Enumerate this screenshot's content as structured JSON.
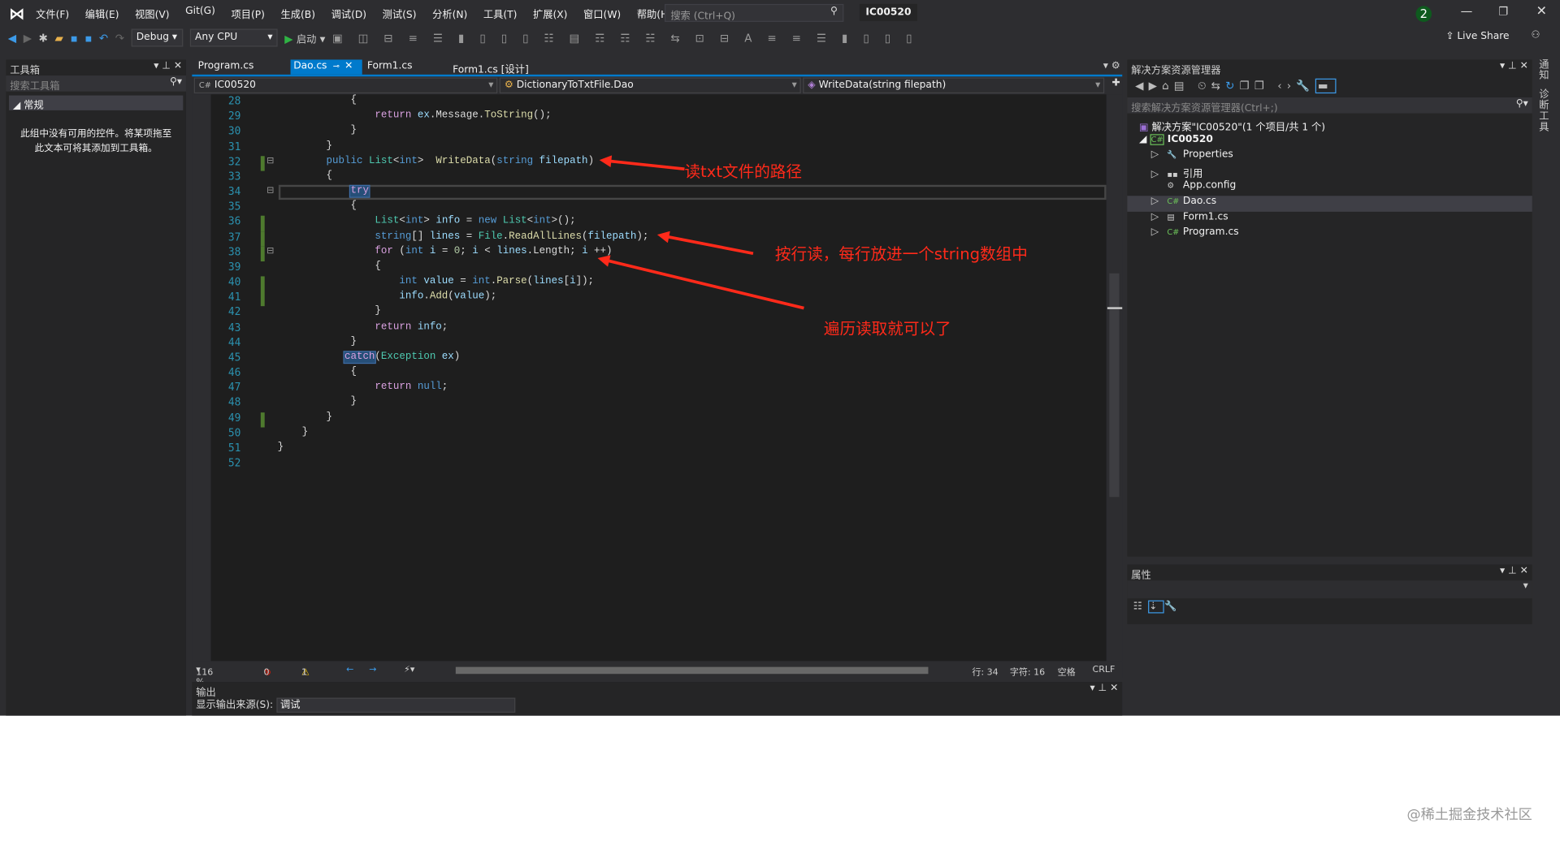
{
  "menu": [
    "文件(F)",
    "编辑(E)",
    "视图(V)",
    "Git(G)",
    "项目(P)",
    "生成(B)",
    "调试(D)",
    "测试(S)",
    "分析(N)",
    "工具(T)",
    "扩展(X)",
    "窗口(W)",
    "帮助(H)"
  ],
  "search_placeholder": "搜索 (Ctrl+Q)",
  "solution_name": "IC00520",
  "notification_count": "2",
  "toolbar": {
    "config": "Debug",
    "platform": "Any CPU",
    "start": "启动",
    "live_share": "Live Share"
  },
  "toolbox": {
    "title": "工具箱",
    "search": "搜索工具箱",
    "group": "常规",
    "empty_text": "此组中没有可用的控件。将某项拖至此文本可将其添加到工具箱。"
  },
  "tabs": [
    {
      "label": "Program.cs",
      "active": false
    },
    {
      "label": "Dao.cs",
      "active": true
    },
    {
      "label": "Form1.cs",
      "active": false
    },
    {
      "label": "Form1.cs [设计]",
      "active": false
    }
  ],
  "nav": {
    "project": "IC00520",
    "class": "DictionaryToTxtFile.Dao",
    "member": "WriteData(string filepath)"
  },
  "code": [
    {
      "n": 28,
      "t": [
        [
          "            {",
          ""
        ]
      ]
    },
    {
      "n": 29,
      "t": [
        [
          "                ",
          ""
        ],
        [
          "return",
          "ct"
        ],
        [
          " ",
          ""
        ],
        [
          "ex",
          "va"
        ],
        [
          ".Message.",
          ""
        ],
        [
          "ToString",
          "me"
        ],
        [
          "();",
          ""
        ]
      ]
    },
    {
      "n": 30,
      "t": [
        [
          "            }",
          ""
        ]
      ]
    },
    {
      "n": 31,
      "t": [
        [
          "        }",
          ""
        ]
      ]
    },
    {
      "n": 32,
      "t": [
        [
          "        ",
          ""
        ],
        [
          "public",
          "kw"
        ],
        [
          " ",
          ""
        ],
        [
          "List",
          "ty"
        ],
        [
          "<",
          ""
        ],
        [
          "int",
          "kw"
        ],
        [
          ">  ",
          ""
        ],
        [
          "WriteData",
          "me"
        ],
        [
          "(",
          ""
        ],
        [
          "string",
          "kw"
        ],
        [
          " ",
          ""
        ],
        [
          "filepath",
          "va"
        ],
        [
          ")",
          ""
        ]
      ]
    },
    {
      "n": 33,
      "t": [
        [
          "        {",
          ""
        ]
      ]
    },
    {
      "n": 34,
      "t": [
        [
          "            ",
          ""
        ],
        [
          "try",
          "sel ct"
        ]
      ]
    },
    {
      "n": 35,
      "t": [
        [
          "            {",
          ""
        ]
      ]
    },
    {
      "n": 36,
      "t": [
        [
          "                ",
          ""
        ],
        [
          "List",
          "ty"
        ],
        [
          "<",
          ""
        ],
        [
          "int",
          "kw"
        ],
        [
          "> ",
          ""
        ],
        [
          "info",
          "va"
        ],
        [
          " = ",
          ""
        ],
        [
          "new",
          "kw"
        ],
        [
          " ",
          ""
        ],
        [
          "List",
          "ty"
        ],
        [
          "<",
          ""
        ],
        [
          "int",
          "kw"
        ],
        [
          ">();",
          ""
        ]
      ]
    },
    {
      "n": 37,
      "t": [
        [
          "                ",
          ""
        ],
        [
          "string",
          "kw"
        ],
        [
          "[] ",
          ""
        ],
        [
          "lines",
          "va"
        ],
        [
          " = ",
          ""
        ],
        [
          "File",
          "ty"
        ],
        [
          ".",
          ""
        ],
        [
          "ReadAllLines",
          "me"
        ],
        [
          "(",
          ""
        ],
        [
          "filepath",
          "va"
        ],
        [
          ");",
          ""
        ]
      ]
    },
    {
      "n": 38,
      "t": [
        [
          "                ",
          ""
        ],
        [
          "for",
          "ct"
        ],
        [
          " (",
          ""
        ],
        [
          "int",
          "kw"
        ],
        [
          " ",
          ""
        ],
        [
          "i",
          "va"
        ],
        [
          " = ",
          ""
        ],
        [
          "0",
          "nu"
        ],
        [
          "; ",
          ""
        ],
        [
          "i",
          "va"
        ],
        [
          " < ",
          ""
        ],
        [
          "lines",
          "va"
        ],
        [
          ".Length; ",
          ""
        ],
        [
          "i",
          "va"
        ],
        [
          " ++)",
          ""
        ]
      ]
    },
    {
      "n": 39,
      "t": [
        [
          "                {",
          ""
        ]
      ]
    },
    {
      "n": 40,
      "t": [
        [
          "                    ",
          ""
        ],
        [
          "int",
          "kw"
        ],
        [
          " ",
          ""
        ],
        [
          "value",
          "va"
        ],
        [
          " = ",
          ""
        ],
        [
          "int",
          "kw"
        ],
        [
          ".",
          ""
        ],
        [
          "Parse",
          "me"
        ],
        [
          "(",
          ""
        ],
        [
          "lines",
          "va"
        ],
        [
          "[",
          ""
        ],
        [
          "i",
          "va"
        ],
        [
          "]);",
          ""
        ]
      ]
    },
    {
      "n": 41,
      "t": [
        [
          "                    ",
          ""
        ],
        [
          "info",
          "va"
        ],
        [
          ".",
          ""
        ],
        [
          "Add",
          "me"
        ],
        [
          "(",
          ""
        ],
        [
          "value",
          "va"
        ],
        [
          ");",
          ""
        ]
      ]
    },
    {
      "n": 42,
      "t": [
        [
          "                }",
          ""
        ]
      ]
    },
    {
      "n": 43,
      "t": [
        [
          "                ",
          ""
        ],
        [
          "return",
          "ct"
        ],
        [
          " ",
          ""
        ],
        [
          "info",
          "va"
        ],
        [
          ";",
          ""
        ]
      ]
    },
    {
      "n": 44,
      "t": [
        [
          "            }",
          ""
        ]
      ]
    },
    {
      "n": 45,
      "t": [
        [
          "           ",
          ""
        ],
        [
          "catch",
          "sel ct"
        ],
        [
          "(",
          ""
        ],
        [
          "Exception",
          "ty"
        ],
        [
          " ",
          ""
        ],
        [
          "ex",
          "va"
        ],
        [
          ")",
          ""
        ]
      ]
    },
    {
      "n": 46,
      "t": [
        [
          "            {",
          ""
        ]
      ]
    },
    {
      "n": 47,
      "t": [
        [
          "                ",
          ""
        ],
        [
          "return",
          "ct"
        ],
        [
          " ",
          ""
        ],
        [
          "null",
          "kw"
        ],
        [
          ";",
          ""
        ]
      ]
    },
    {
      "n": 48,
      "t": [
        [
          "            }",
          ""
        ]
      ]
    },
    {
      "n": 49,
      "t": [
        [
          "        }",
          ""
        ]
      ]
    },
    {
      "n": 50,
      "t": [
        [
          "    }",
          ""
        ]
      ]
    },
    {
      "n": 51,
      "t": [
        [
          "}",
          ""
        ]
      ]
    },
    {
      "n": 52,
      "t": []
    }
  ],
  "annotations": [
    "读txt文件的路径",
    "按行读，每行放进一个string数组中",
    "遍历读取就可以了"
  ],
  "status": {
    "zoom": "116 %",
    "errors": "0",
    "warnings": "1",
    "line": "行: 34",
    "char": "字符: 16",
    "spaces": "空格",
    "eol": "CRLF"
  },
  "output": {
    "title": "输出",
    "source_label": "显示输出来源(S):",
    "source": "调试"
  },
  "solution_explorer": {
    "title": "解决方案资源管理器",
    "search": "搜索解决方案资源管理器(Ctrl+;)",
    "solution": "解决方案\"IC00520\"(1 个项目/共 1 个)",
    "project": "IC00520",
    "items": [
      "Properties",
      "引用",
      "App.config",
      "Dao.cs",
      "Form1.cs",
      "Program.cs"
    ],
    "selected": "Dao.cs"
  },
  "properties": {
    "title": "属性"
  },
  "side_tabs": [
    "通知",
    "诊断工具"
  ],
  "watermark": "@稀土掘金技术社区"
}
